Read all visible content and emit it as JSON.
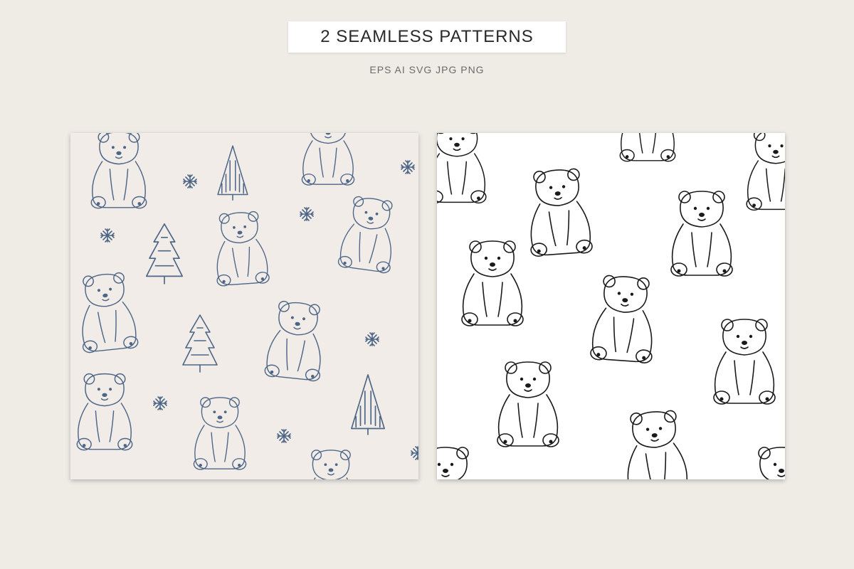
{
  "header": {
    "title": "2 SEAMLESS PATTERNS",
    "formats": "EPS  AI  SVG  JPG  PNG"
  },
  "patterns": [
    {
      "name": "blue-bears-trees-pattern",
      "stroke_color": "#4d6687",
      "background": "#f1ece7"
    },
    {
      "name": "black-bears-pattern",
      "stroke_color": "#1a1a1a",
      "background": "#ffffff"
    }
  ],
  "colors": {
    "page_background": "#efece6",
    "title_box": "#ffffff"
  }
}
